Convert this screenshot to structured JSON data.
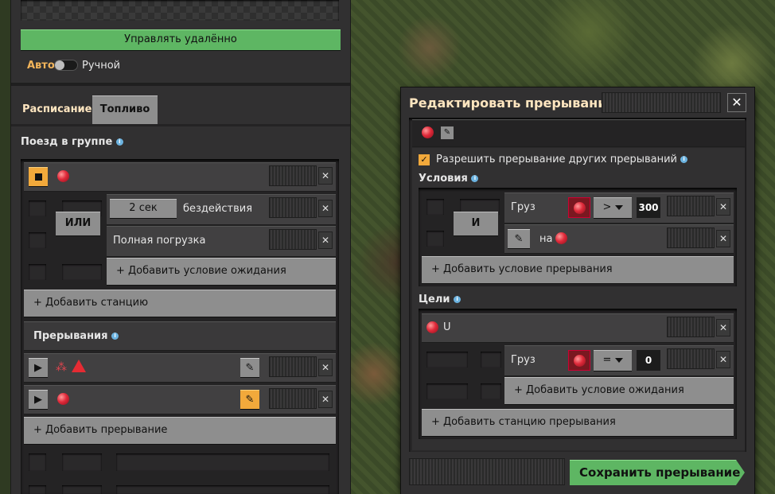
{
  "left": {
    "remote_button": "Управлять удалённо",
    "auto_label": "Авто",
    "manual_label": "Ручной",
    "tabs": [
      "Расписание",
      "Топливо"
    ],
    "group_label": "Поезд в группе",
    "station": {
      "or_label": "ИЛИ",
      "cond1_value": "2 сек",
      "cond1_text": "бездействия",
      "cond2_text": "Полная погрузка",
      "add_wait": "+ Добавить условие ожидания"
    },
    "add_station": "+ Добавить станцию",
    "interrupts_label": "Прерывания",
    "add_interrupt": "+ Добавить прерывание"
  },
  "dialog": {
    "title": "Редактировать прерывание",
    "allow_label": "Разрешить прерывание других прерываний",
    "conditions_label": "Условия",
    "and_label": "И",
    "cargo_label": "Груз",
    "op1": ">",
    "val1": "300",
    "on_label": "на",
    "add_interrupt_condition": "+ Добавить условие прерывания",
    "targets_label": "Цели",
    "target_station": "U",
    "cargo2_label": "Груз",
    "op2": "=",
    "val2": "0",
    "add_wait2": "+ Добавить условие ожидания",
    "add_interrupt_station": "+ Добавить станцию прерывания",
    "save": "Сохранить прерывание"
  },
  "colors": {
    "accent_green": "#5eb663",
    "accent_orange": "#f2a93b",
    "title": "#ffe6c0"
  }
}
